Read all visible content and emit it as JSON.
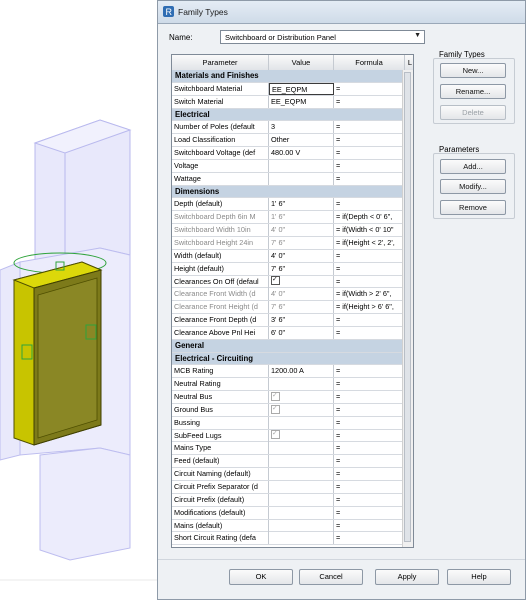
{
  "dialog": {
    "title": "Family Types",
    "name_label": "Name:",
    "name_value": "Switchboard or Distribution Panel"
  },
  "grid": {
    "headers": [
      "Parameter",
      "Value",
      "Formula",
      "L"
    ],
    "rows": [
      {
        "type": "group",
        "label": "Materials and Finishes"
      },
      {
        "param": "Switchboard Material",
        "value": "EE_EQPM",
        "formula": "=",
        "lock": "",
        "edit": true
      },
      {
        "param": "Switch Material",
        "value": "EE_EQPM",
        "formula": "=",
        "lock": ""
      },
      {
        "type": "group",
        "label": "Electrical"
      },
      {
        "param": "Number of Poles (default",
        "value": "3",
        "formula": "=",
        "lock": ""
      },
      {
        "param": "Load Classification",
        "value": "Other",
        "formula": "=",
        "lock": ""
      },
      {
        "param": "Switchboard Voltage (def",
        "value": "480.00 V",
        "formula": "=",
        "lock": ""
      },
      {
        "param": "Voltage",
        "value": "",
        "formula": "=",
        "lock": ""
      },
      {
        "param": "Wattage",
        "value": "",
        "formula": "=",
        "lock": ""
      },
      {
        "type": "group",
        "label": "Dimensions"
      },
      {
        "param": "Depth (default)",
        "value": "1'  6\"",
        "formula": "=",
        "lock": "box"
      },
      {
        "param": "Switchboard Depth 6in M",
        "value": "1'  6\"",
        "formula": "= if(Depth < 0'  6\",",
        "lock": "box",
        "grey": true
      },
      {
        "param": "Switchboard Width 10in",
        "value": "4'  0\"",
        "formula": "= if(Width < 0'  10\"",
        "lock": "box",
        "grey": true
      },
      {
        "param": "Switchboard Height 24in",
        "value": "7'  6\"",
        "formula": "= if(Height < 2',  2',",
        "lock": "box",
        "grey": true
      },
      {
        "param": "Width (default)",
        "value": "4'  0\"",
        "formula": "=",
        "lock": "box"
      },
      {
        "param": "Height (default)",
        "value": "7'  6\"",
        "formula": "=",
        "lock": "box"
      },
      {
        "param": "Clearances On Off (defaul",
        "value": "",
        "check": "on",
        "formula": "=",
        "lock": ""
      },
      {
        "param": "Clearance Front Width (d",
        "value": "4'  0\"",
        "formula": "= if(Width > 2'  6\",",
        "lock": "box",
        "grey": true
      },
      {
        "param": "Clearance Front Height (d",
        "value": "7'  6\"",
        "formula": "= if(Height > 6'  6\",",
        "lock": "box",
        "grey": true
      },
      {
        "param": "Clearance Front Depth (d",
        "value": "3'  6\"",
        "formula": "=",
        "lock": "box"
      },
      {
        "param": "Clearance Above Pnl Hei",
        "value": "6'  0\"",
        "formula": "=",
        "lock": "box"
      },
      {
        "type": "group",
        "label": "General"
      },
      {
        "type": "group",
        "label": "Electrical - Circuiting"
      },
      {
        "param": "MCB Rating",
        "value": "1200.00 A",
        "formula": "=",
        "lock": ""
      },
      {
        "param": "Neutral Rating",
        "value": "",
        "formula": "=",
        "lock": ""
      },
      {
        "param": "Neutral Bus",
        "value": "",
        "check": "dis-on",
        "formula": "=",
        "lock": ""
      },
      {
        "param": "Ground Bus",
        "value": "",
        "check": "dis-on",
        "formula": "=",
        "lock": ""
      },
      {
        "param": "Bussing",
        "value": "",
        "formula": "=",
        "lock": ""
      },
      {
        "param": "SubFeed Lugs",
        "value": "",
        "check": "dis-on",
        "formula": "=",
        "lock": ""
      },
      {
        "param": "Mains Type",
        "value": "",
        "formula": "=",
        "lock": ""
      },
      {
        "param": "Feed (default)",
        "value": "",
        "formula": "=",
        "lock": ""
      },
      {
        "param": "Circuit Naming (default)",
        "value": "",
        "formula": "=",
        "lock": ""
      },
      {
        "param": "Circuit Prefix Separator (d",
        "value": "",
        "formula": "=",
        "lock": ""
      },
      {
        "param": "Circuit Prefix (default)",
        "value": "",
        "formula": "=",
        "lock": ""
      },
      {
        "param": "Modifications (default)",
        "value": "",
        "formula": "=",
        "lock": ""
      },
      {
        "param": "Mains (default)",
        "value": "",
        "formula": "=",
        "lock": ""
      },
      {
        "param": "Short Circuit Rating (defa",
        "value": "",
        "formula": "=",
        "lock": ""
      }
    ]
  },
  "family_types": {
    "title": "Family Types",
    "new": "New...",
    "rename": "Rename...",
    "delete": "Delete"
  },
  "parameters": {
    "title": "Parameters",
    "add": "Add...",
    "modify": "Modify...",
    "remove": "Remove"
  },
  "buttons": {
    "ok": "OK",
    "cancel": "Cancel",
    "apply": "Apply",
    "help": "Help"
  }
}
